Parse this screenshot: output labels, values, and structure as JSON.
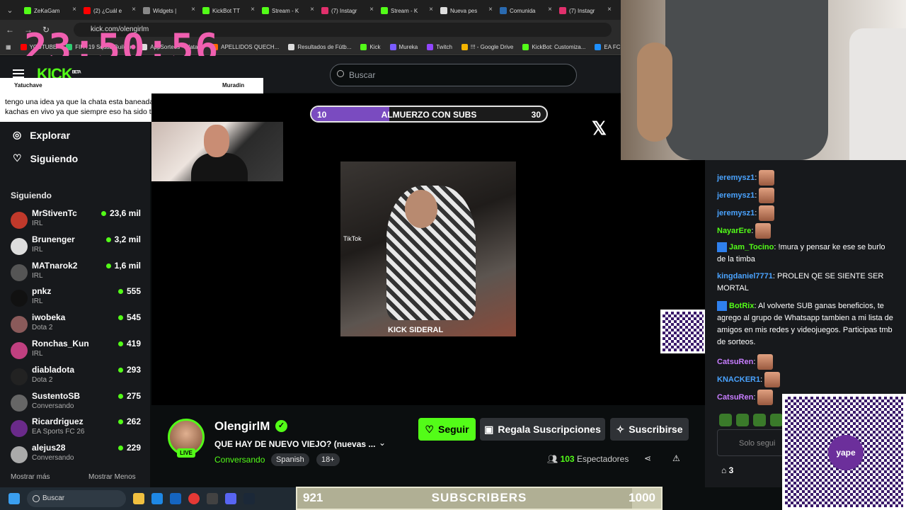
{
  "browser": {
    "tabs": [
      {
        "label": "ZeKaGam",
        "color": "#53fc18"
      },
      {
        "label": "(2) ¿Cuál e",
        "color": "#ff0000"
      },
      {
        "label": "Widgets |",
        "color": "#888888"
      },
      {
        "label": "KickBot TT",
        "color": "#53fc18"
      },
      {
        "label": "Stream - K",
        "color": "#53fc18"
      },
      {
        "label": "(7) Instagr",
        "color": "#e1306c"
      },
      {
        "label": "Stream - K",
        "color": "#53fc18"
      },
      {
        "label": "Nueva pes",
        "color": "#dddddd"
      },
      {
        "label": "Comunida",
        "color": "#2a6ab0"
      },
      {
        "label": "(7) Instagr",
        "color": "#e1306c"
      }
    ],
    "url": "kick.com/olengirlm",
    "bookmarks": [
      {
        "label": "YOUTUBE",
        "color": "#ff0000"
      },
      {
        "label": "FIFA 19 Squad Builder",
        "color": "#2ecc71"
      },
      {
        "label": "AppSorteos - Plata...",
        "color": "#dddddd"
      },
      {
        "label": "APELLIDOS QUECH...",
        "color": "#ff6600"
      },
      {
        "label": "Resultados de Fútb...",
        "color": "#dddddd"
      },
      {
        "label": "Kick",
        "color": "#53fc18"
      },
      {
        "label": "Mureka",
        "color": "#7a5cff"
      },
      {
        "label": "Twitch",
        "color": "#9146ff"
      },
      {
        "label": "!!! - Google Drive",
        "color": "#f4b400"
      },
      {
        "label": "KickBot: Customiza...",
        "color": "#53fc18"
      },
      {
        "label": "EA FC 2",
        "color": "#1e90ff"
      }
    ]
  },
  "overlay": {
    "clock": "23:50:56",
    "chat_user": "Yatuchave",
    "chat_user2": "Muradin",
    "chat_message": "tengo una idea ya que la chata esta baneada trae a sofi tu terror y te la kachas en vivo ya que siempre eso ha sido tu sueño mi king",
    "goal": {
      "start": "10",
      "title": "ALMUERZO CON SUBS",
      "end": "30",
      "progress": 0.33,
      "color": "#7a4bc0"
    },
    "subs": {
      "start": "921",
      "label": "SUBSCRIBERS",
      "end": "1000",
      "progress": 0.92
    },
    "tiktok": "TikTok",
    "video_watermark": "KICK SIDERAL"
  },
  "kick": {
    "logo": "KICK",
    "logo_beta": "BETA",
    "search_placeholder": "Buscar",
    "nav": {
      "explore": "Explorar",
      "following": "Siguiendo"
    },
    "following_header": "Siguiendo",
    "following": [
      {
        "name": "MrStivenTc",
        "category": "IRL",
        "viewers": "23,6 mil",
        "color": "#c0392b"
      },
      {
        "name": "Brunenger",
        "category": "IRL",
        "viewers": "3,2 mil",
        "color": "#dddddd"
      },
      {
        "name": "MATnarok2",
        "category": "IRL",
        "viewers": "1,6 mil",
        "color": "#555555"
      },
      {
        "name": "pnkz",
        "category": "IRL",
        "viewers": "555",
        "color": "#111111"
      },
      {
        "name": "iwobeka",
        "category": "Dota 2",
        "viewers": "545",
        "color": "#8a5a5a"
      },
      {
        "name": "Ronchas_Kun",
        "category": "IRL",
        "viewers": "419",
        "color": "#c04080"
      },
      {
        "name": "diabladota",
        "category": "Dota 2",
        "viewers": "293",
        "color": "#222222"
      },
      {
        "name": "SustentoSB",
        "category": "Conversando",
        "viewers": "275",
        "color": "#666666"
      },
      {
        "name": "Ricardriguez",
        "category": "EA Sports FC 26",
        "viewers": "262",
        "color": "#6a2a8a"
      },
      {
        "name": "alejus28",
        "category": "Conversando",
        "viewers": "229",
        "color": "#aaaaaa"
      }
    ],
    "show_more": "Mostrar más",
    "show_less": "Mostrar Menos",
    "channel": {
      "name": "OlengirlM",
      "live_badge": "LIVE",
      "title": "QUE HAY DE NUEVO VIEJO?  (nuevas ...",
      "category": "Conversando",
      "tags": [
        "Spanish",
        "18+"
      ],
      "follow": "Seguir",
      "gift": "Regala Suscripciones",
      "subscribe": "Suscribirse",
      "viewers_count": "103",
      "viewers_label": "Espectadores"
    },
    "chat": {
      "messages": [
        {
          "user": "jeremysz1",
          "color": "#4aa3ff",
          "text": ""
        },
        {
          "user": "jeremysz1",
          "color": "#4aa3ff",
          "text": ""
        },
        {
          "user": "jeremysz1",
          "color": "#4aa3ff",
          "text": ""
        },
        {
          "user": "NayarEre",
          "color": "#53fc18",
          "text": ""
        },
        {
          "user": "Jam_Tocino",
          "color": "#53fc18",
          "text": "!mura y pensar ke ese se burlo de la timba"
        },
        {
          "user": "kingdaniel7771",
          "color": "#4aa3ff",
          "text": "PROLEN QE SE SIENTE SER MORTAL"
        },
        {
          "user": "BotRix",
          "color": "#53fc18",
          "text": "Al volverte SUB ganas beneficios, te agrego al grupo de Whatsapp tambien a mi lista de amigos en mis redes y videojuegos. Participas tmb de sorteos."
        },
        {
          "user": "CatsuRen",
          "color": "#c77dff",
          "text": ""
        },
        {
          "user": "KNACKER1",
          "color": "#4aa3ff",
          "text": ""
        },
        {
          "user": "CatsuRen",
          "color": "#c77dff",
          "text": ""
        }
      ],
      "input_placeholder": "Solo segui",
      "store_count": "3"
    }
  },
  "yape": {
    "logo": "yape"
  },
  "taskbar": {
    "search": "Buscar"
  }
}
